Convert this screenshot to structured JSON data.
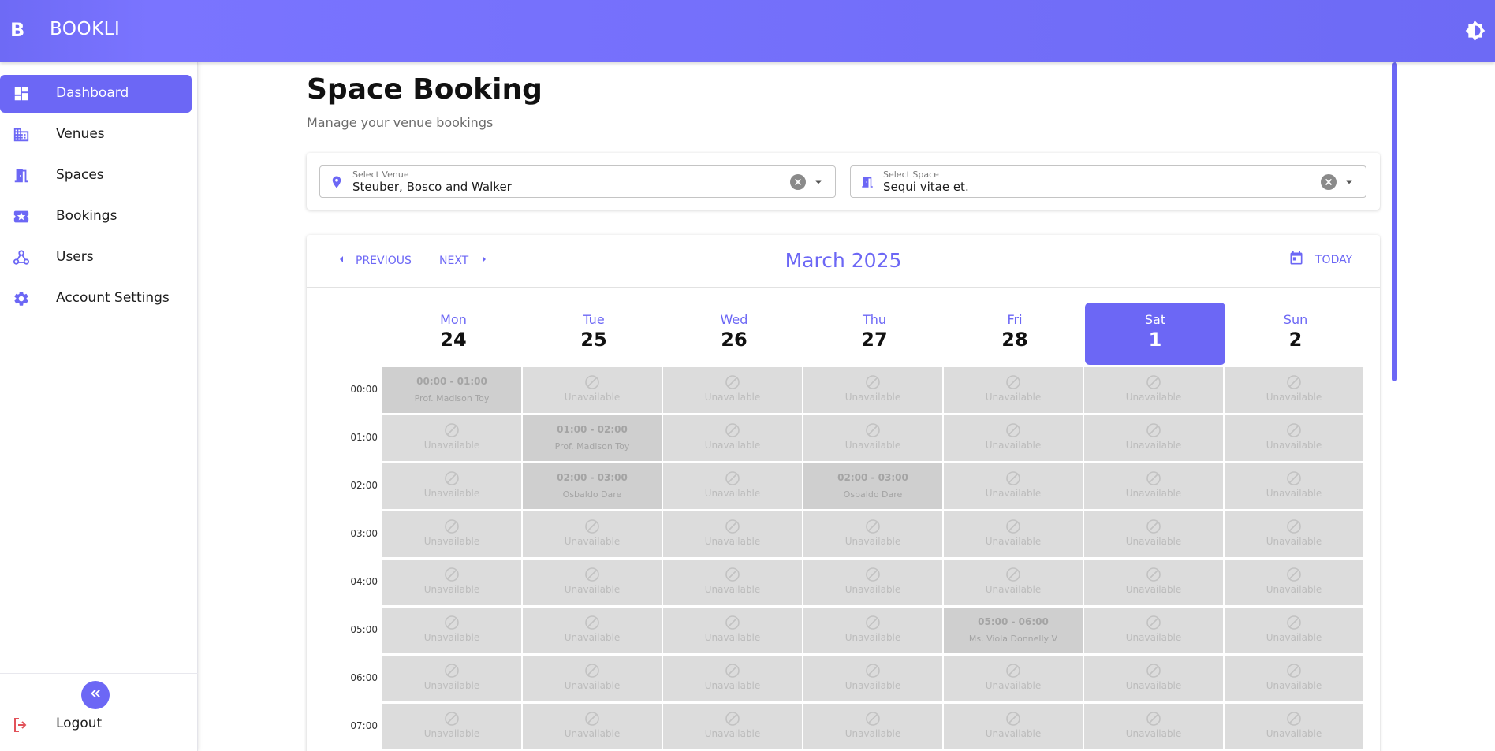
{
  "app": {
    "logo": "B",
    "name": "BOOKLI",
    "theme_icon": "brightness-icon"
  },
  "sidebar": {
    "items": [
      {
        "key": "dashboard",
        "label": "Dashboard",
        "icon": "dashboard-icon",
        "active": true
      },
      {
        "key": "venues",
        "label": "Venues",
        "icon": "building-icon",
        "active": false
      },
      {
        "key": "spaces",
        "label": "Spaces",
        "icon": "door-icon",
        "active": false
      },
      {
        "key": "bookings",
        "label": "Bookings",
        "icon": "ticket-icon",
        "active": false
      },
      {
        "key": "users",
        "label": "Users",
        "icon": "users-icon",
        "active": false
      },
      {
        "key": "account-settings",
        "label": "Account Settings",
        "icon": "gear-icon",
        "active": false
      }
    ],
    "logout_label": "Logout"
  },
  "page": {
    "title": "Space Booking",
    "subtitle": "Manage your venue bookings"
  },
  "filters": {
    "venue": {
      "label": "Select Venue",
      "value": "Steuber, Bosco and Walker"
    },
    "space": {
      "label": "Select Space",
      "value": "Sequi vitae et."
    }
  },
  "calendar": {
    "previous_label": "PREVIOUS",
    "next_label": "NEXT",
    "month_title": "March 2025",
    "today_label": "TODAY",
    "unavailable_label": "Unavailable",
    "days": [
      {
        "name": "Mon",
        "num": "24",
        "today": false
      },
      {
        "name": "Tue",
        "num": "25",
        "today": false
      },
      {
        "name": "Wed",
        "num": "26",
        "today": false
      },
      {
        "name": "Thu",
        "num": "27",
        "today": false
      },
      {
        "name": "Fri",
        "num": "28",
        "today": false
      },
      {
        "name": "Sat",
        "num": "1",
        "today": true
      },
      {
        "name": "Sun",
        "num": "2",
        "today": false
      }
    ],
    "hours": [
      "00:00",
      "01:00",
      "02:00",
      "03:00",
      "04:00",
      "05:00",
      "06:00",
      "07:00"
    ],
    "bookings": [
      {
        "day": 0,
        "hour": 0,
        "time": "00:00 - 01:00",
        "guest": "Prof. Madison Toy"
      },
      {
        "day": 1,
        "hour": 1,
        "time": "01:00 - 02:00",
        "guest": "Prof. Madison Toy"
      },
      {
        "day": 1,
        "hour": 2,
        "time": "02:00 - 03:00",
        "guest": "Osbaldo Dare"
      },
      {
        "day": 3,
        "hour": 2,
        "time": "02:00 - 03:00",
        "guest": "Osbaldo Dare"
      },
      {
        "day": 4,
        "hour": 5,
        "time": "05:00 - 06:00",
        "guest": "Ms. Viola Donnelly V"
      }
    ]
  },
  "colors": {
    "accent": "#6c67f5",
    "slot": "#dcdcdc",
    "slot_booked": "#cfcfcf",
    "logout": "#e2525a"
  }
}
